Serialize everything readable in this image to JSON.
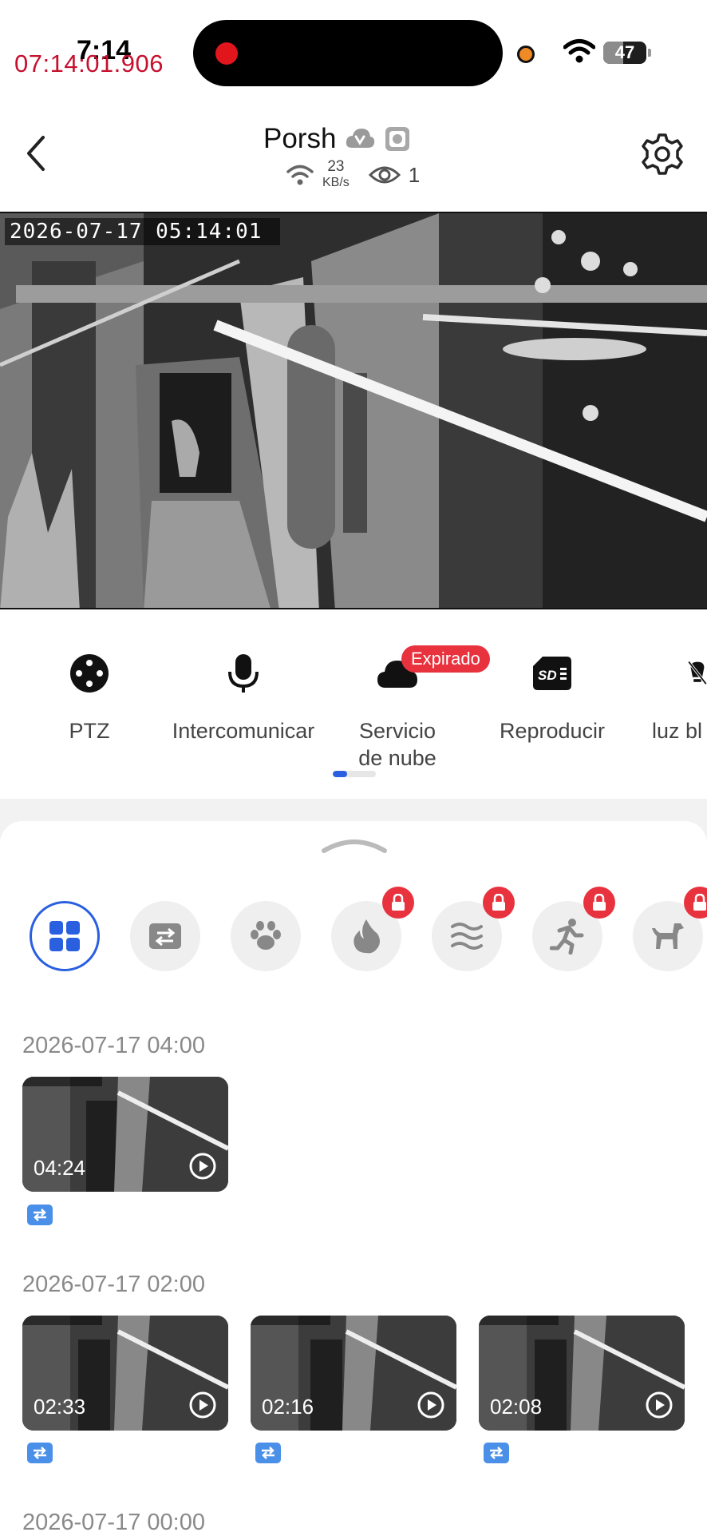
{
  "status_bar": {
    "clock": "7:14",
    "recording_time": "07:14:01.906",
    "battery": "47",
    "battery_level": 0.47
  },
  "header": {
    "title": "Porsh",
    "speed_value": "23",
    "speed_unit": "KB/s",
    "viewer_count": "1"
  },
  "video": {
    "timestamp": "2026-07-17  05:14:01"
  },
  "toolbar": {
    "items": [
      {
        "label": "PTZ",
        "icon": "ptz-icon"
      },
      {
        "label": "Intercomunicar",
        "icon": "microphone-icon"
      },
      {
        "label": "Servicio de nube",
        "icon": "cloud-icon",
        "badge": "Expirado"
      },
      {
        "label": "Reproducir",
        "icon": "sd-card-icon"
      },
      {
        "label": "luz bl",
        "icon": "light-off-icon"
      }
    ],
    "page_indicator": {
      "active": 0,
      "total": 3
    }
  },
  "filters": [
    {
      "icon": "all-grid-icon",
      "selected": true,
      "locked": false
    },
    {
      "icon": "motion-transfer-icon",
      "selected": false,
      "locked": false
    },
    {
      "icon": "paw-icon",
      "selected": false,
      "locked": false
    },
    {
      "icon": "fire-icon",
      "selected": false,
      "locked": true
    },
    {
      "icon": "waves-icon",
      "selected": false,
      "locked": true
    },
    {
      "icon": "running-person-icon",
      "selected": false,
      "locked": true
    },
    {
      "icon": "dog-icon",
      "selected": false,
      "locked": true
    }
  ],
  "events": [
    {
      "date": "2026-07-17 04:00",
      "clips": [
        {
          "time": "04:24"
        }
      ]
    },
    {
      "date": "2026-07-17 02:00",
      "clips": [
        {
          "time": "02:33"
        },
        {
          "time": "02:16"
        },
        {
          "time": "02:08"
        }
      ]
    },
    {
      "date": "2026-07-17 00:00",
      "clips": []
    }
  ],
  "colors": {
    "accent": "#2a5fe0",
    "badge_red": "#e8323e",
    "rec_red": "#c8102e",
    "tag_blue": "#4a8fe8"
  }
}
